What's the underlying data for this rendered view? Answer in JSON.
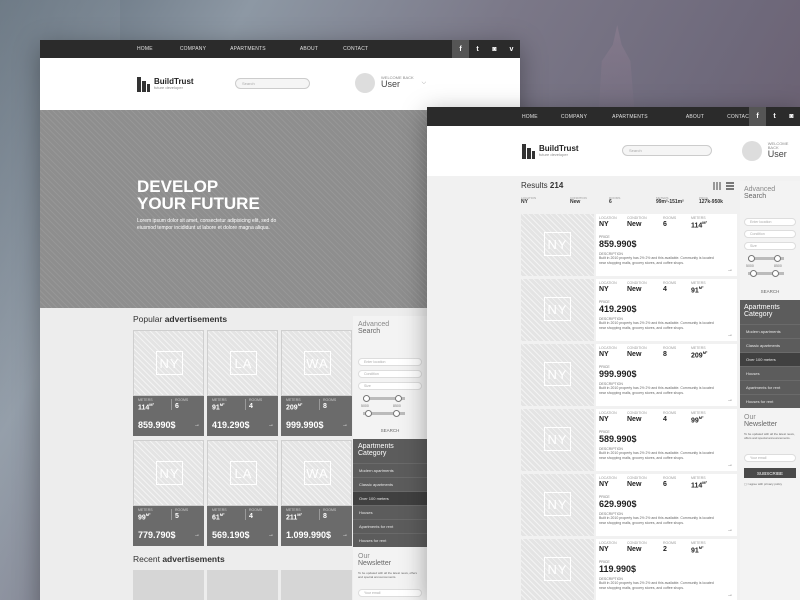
{
  "nav": {
    "links": [
      "HOME",
      "COMPANY",
      "APARTMENTS",
      "ABOUT",
      "CONTACT"
    ],
    "social_icons": [
      "facebook-icon",
      "twitter-icon",
      "instagram-icon",
      "vimeo-icon"
    ],
    "social_glyphs": [
      "f",
      "t",
      "◙",
      "v"
    ]
  },
  "brand": {
    "name": "BuildTrust",
    "tagline": "future developer"
  },
  "search": {
    "placeholder": "Search"
  },
  "user": {
    "welcome": "WELCOME BACK",
    "name": "User"
  },
  "hero": {
    "title_line1": "DEVELOP",
    "title_line2": "YOUR FUTURE",
    "text": "Lorem ipsum dolor sit amet, consectetur adipisicing elit, sed do eiusmod tempor incididunt ut labore et dolore magna aliqua."
  },
  "popular": {
    "title_prefix": "Popular",
    "title_bold": "advertisements",
    "labels": {
      "meters": "METERS",
      "rooms": "ROOMS"
    },
    "unit": "M²",
    "cards": [
      {
        "city": "NY",
        "meters": "114",
        "rooms": "6",
        "price": "859.990$"
      },
      {
        "city": "LA",
        "meters": "91",
        "rooms": "4",
        "price": "419.290$"
      },
      {
        "city": "WA",
        "meters": "209",
        "rooms": "8",
        "price": "999.990$"
      },
      {
        "city": "NY",
        "meters": "99",
        "rooms": "5",
        "price": "779.790$"
      },
      {
        "city": "LA",
        "meters": "61",
        "rooms": "4",
        "price": "569.190$"
      },
      {
        "city": "WA",
        "meters": "211",
        "rooms": "8",
        "price": "1.099.990$"
      }
    ]
  },
  "recent": {
    "title_prefix": "Recent",
    "title_bold": "advertisements"
  },
  "sidebar": {
    "advanced_line1": "Advanced",
    "advanced_line2": "Search",
    "fields": [
      "Enter location",
      "Condition",
      "Size"
    ],
    "slider_labels": [
      "5000",
      "8500"
    ],
    "search_button": "SEARCH",
    "category_line1": "Apartments",
    "category_line2": "Category",
    "categories": [
      "Modern apartments",
      "Classic apartments",
      "Over 100 meters",
      "Houses",
      "Apartments for rent",
      "Houses for rent"
    ],
    "active_category": 2,
    "newsletter_line1": "Our",
    "newsletter_line2": "Newsletter",
    "newsletter_text": "To be updated with all the latest news, offers and special announcements.",
    "email_placeholder": "Your email",
    "subscribe": "SUBSCRIBE",
    "privacy": "I agree with privacy policy"
  },
  "results": {
    "label": "Results",
    "count": "214",
    "filters": [
      {
        "k": "LOCATION",
        "v": "NY"
      },
      {
        "k": "CONDITION",
        "v": "New"
      },
      {
        "k": "ROOMS",
        "v": "6"
      },
      {
        "k": "METERS",
        "v": "99m²-151m²"
      },
      {
        "k": "PRICE",
        "v": "127k-950k"
      }
    ],
    "labels": {
      "location": "LOCATION",
      "condition": "CONDITION",
      "rooms": "ROOMS",
      "meters": "METERS",
      "price": "PRICE",
      "description": "DESCRIPTION"
    },
    "description": "Built in 2010 property has 2½ 2½ and this available. Community is located near shopping malls, grocery stores, and coffee shops.",
    "rows": [
      {
        "city": "NY",
        "location": "NY",
        "condition": "New",
        "rooms": "6",
        "meters": "114",
        "price": "859.990$"
      },
      {
        "city": "NY",
        "location": "NY",
        "condition": "New",
        "rooms": "4",
        "meters": "91",
        "price": "419.290$"
      },
      {
        "city": "NY",
        "location": "NY",
        "condition": "New",
        "rooms": "8",
        "meters": "209",
        "price": "999.990$"
      },
      {
        "city": "NY",
        "location": "NY",
        "condition": "New",
        "rooms": "4",
        "meters": "99",
        "price": "589.990$"
      },
      {
        "city": "NY",
        "location": "NY",
        "condition": "New",
        "rooms": "6",
        "meters": "114",
        "price": "629.990$"
      },
      {
        "city": "NY",
        "location": "NY",
        "condition": "New",
        "rooms": "2",
        "meters": "91",
        "price": "119.990$"
      }
    ]
  }
}
